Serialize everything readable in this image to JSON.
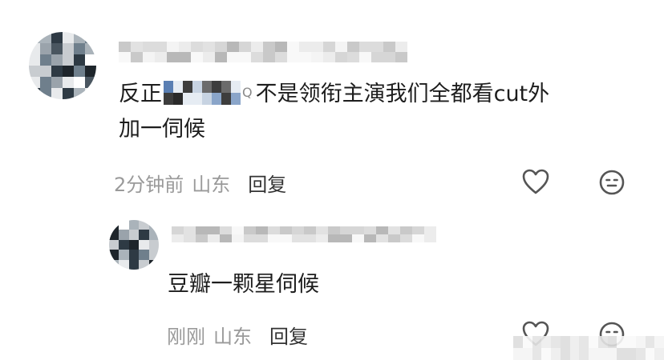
{
  "comments": [
    {
      "text_prefix": "反正",
      "mention_suffix_mark": "Q",
      "text_line1_rest": "不是领衔主演我们全都看cut外",
      "text_line2": "加一伺候",
      "time": "2分钟前",
      "location": "山东",
      "reply_label": "回复"
    },
    {
      "text": "豆瓣一颗星伺候",
      "time": "刚刚",
      "location": "山东",
      "reply_label": "回复"
    }
  ],
  "icons": [
    "heart-icon",
    "meh-face-icon"
  ],
  "colors": {
    "text": "#1d1d1d",
    "meta": "#9a9a9a",
    "reply": "#333333",
    "icon": "#555555"
  }
}
